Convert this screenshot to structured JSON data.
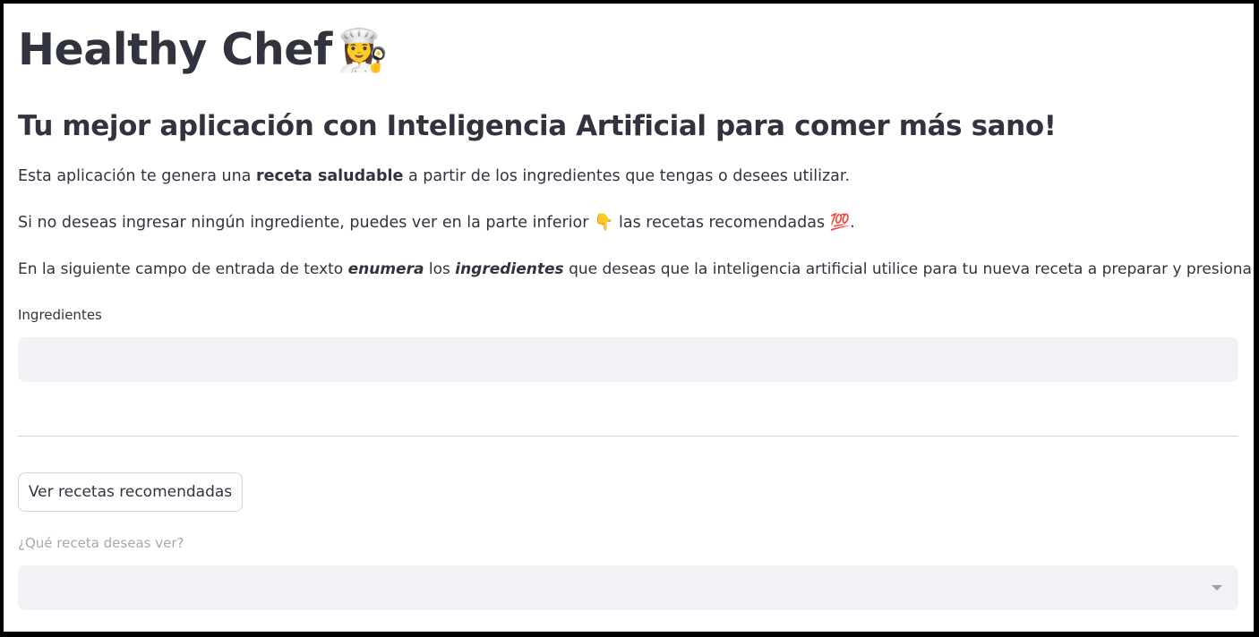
{
  "header": {
    "title": "Healthy Chef",
    "title_emoji": "👩‍🍳",
    "subtitle": "Tu mejor aplicación con Inteligencia Artificial para comer más sano!"
  },
  "intro": {
    "p1_a": "Esta aplicación te genera una ",
    "p1_bold": "receta saludable",
    "p1_b": " a partir de los ingredientes que tengas o desees utilizar.",
    "p2_a": "Si no deseas ingresar ningún ingrediente, puedes ver en la parte inferior ",
    "p2_emoji_down": "👇",
    "p2_b": " las recetas recomendadas ",
    "p2_emoji_100": "💯",
    "p2_c": ".",
    "p3_a": "En la siguiente campo de entrada de texto ",
    "p3_em1": "enumera",
    "p3_b": " los ",
    "p3_em2": "ingredientes",
    "p3_c": " que deseas que la inteligencia artificial utilice para tu nueva receta a preparar y presiona Enter."
  },
  "ingredients_input": {
    "label": "Ingredientes",
    "value": "",
    "placeholder": ""
  },
  "recommended_button": {
    "label": "Ver recetas recomendadas"
  },
  "recipe_select": {
    "label": "¿Qué receta deseas ver?",
    "selected": "",
    "icon": "chevron-down-icon"
  },
  "colors": {
    "text": "#31333f",
    "input_bg": "#f0f2f6",
    "muted_label": "#a3a8b4",
    "divider": "#d6d6d9",
    "frame": "#000000"
  }
}
